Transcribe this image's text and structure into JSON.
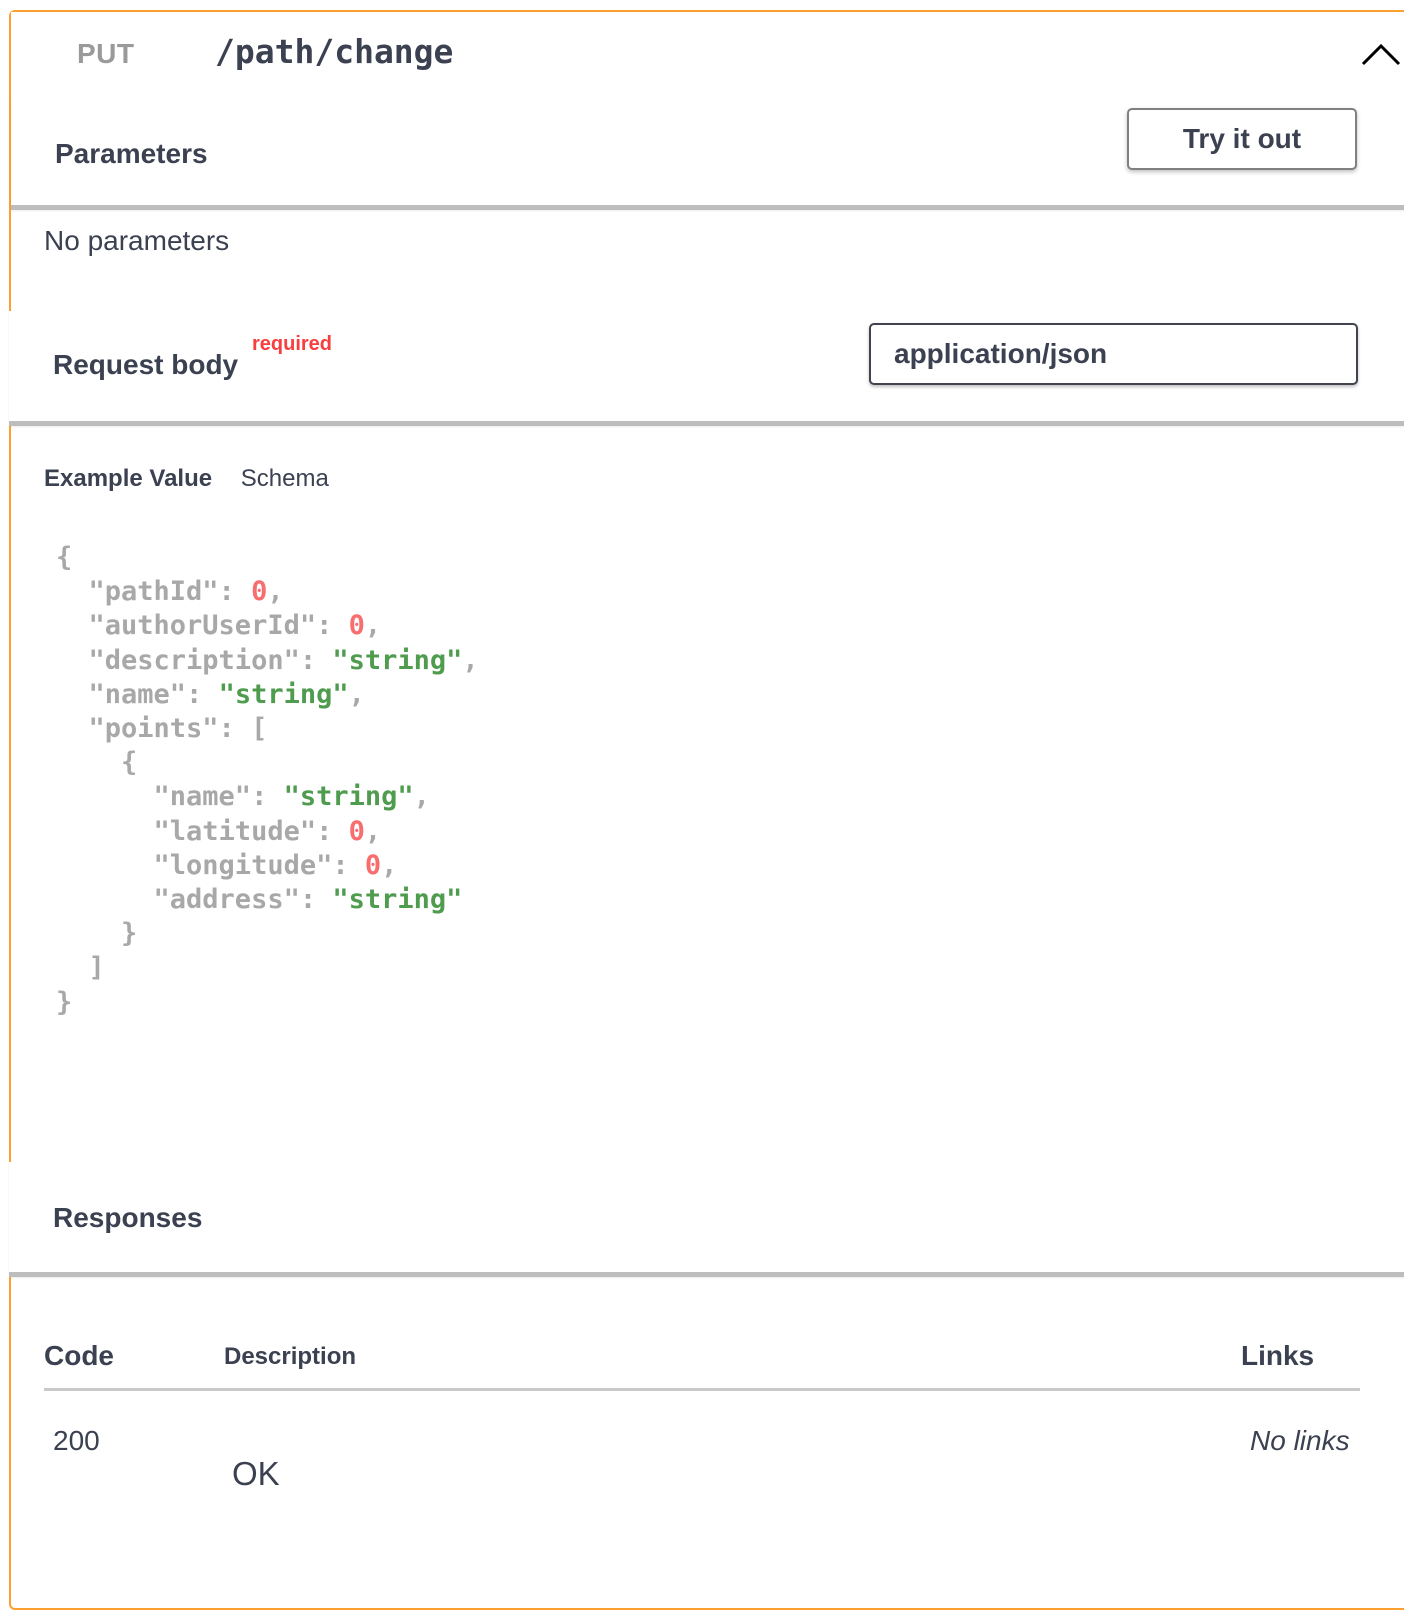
{
  "operation": {
    "method": "PUT",
    "path": "/path/change"
  },
  "parameters": {
    "title": "Parameters",
    "try_button": "Try it out",
    "empty_text": "No parameters"
  },
  "request_body": {
    "title": "Request body",
    "required_label": "required",
    "content_type": "application/json",
    "tabs": [
      "Example Value",
      "Schema"
    ],
    "active_tab": "Example Value",
    "example_lines": [
      "{",
      "  \"pathId\": 0,",
      "  \"authorUserId\": 0,",
      "  \"description\": \"string\",",
      "  \"name\": \"string\",",
      "  \"points\": [",
      "    {",
      "      \"name\": \"string\",",
      "      \"latitude\": 0,",
      "      \"longitude\": 0,",
      "      \"address\": \"string\"",
      "    }",
      "  ]",
      "}"
    ]
  },
  "responses": {
    "title": "Responses",
    "headers": {
      "code": "Code",
      "description": "Description",
      "links": "Links"
    },
    "rows": [
      {
        "code": "200",
        "description": "OK",
        "links": "No links"
      }
    ]
  },
  "colors": {
    "accent": "#fca130",
    "number": "#f86d6d",
    "string": "#4f9c4f",
    "required": "#f93e3e"
  },
  "icons": {
    "collapse": "chevron-up-icon"
  }
}
